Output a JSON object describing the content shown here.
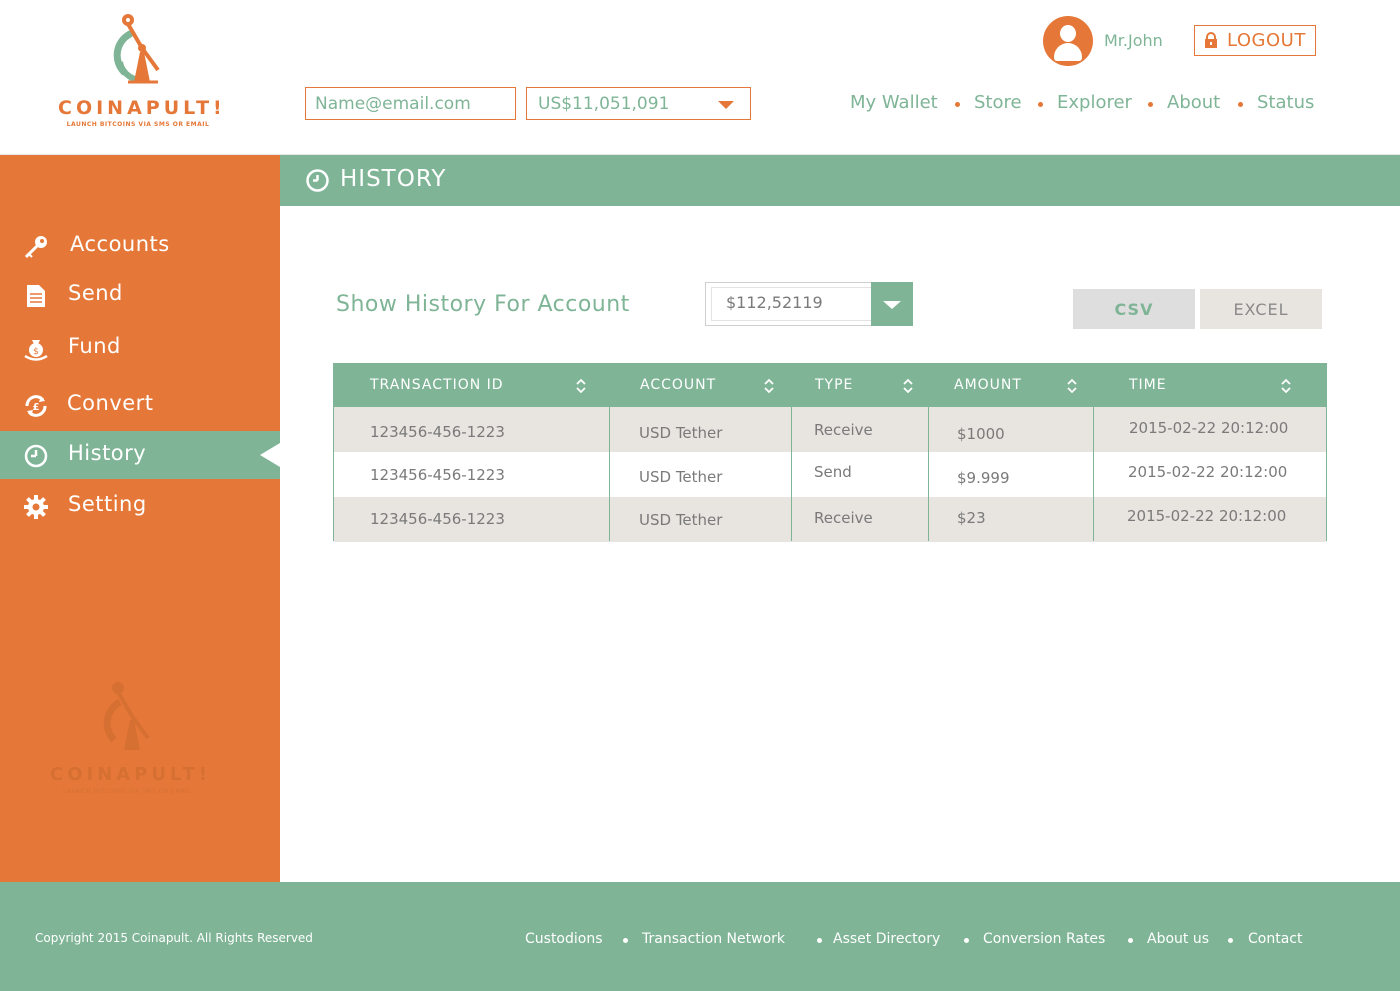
{
  "brand": {
    "name": "COINAPULT!",
    "tagline": "LAUNCH BITCOINS VIA SMS OR EMAIL",
    "orange": "#e57838",
    "green": "#7fb596"
  },
  "header": {
    "email_placeholder": "Name@email.com",
    "balance_value": "US$11,051,091",
    "user_name": "Mr.John",
    "logout_label": "LOGOUT",
    "nav": [
      {
        "label": "My Wallet"
      },
      {
        "label": "Store"
      },
      {
        "label": "Explorer"
      },
      {
        "label": "About"
      },
      {
        "label": "Status"
      }
    ]
  },
  "sidebar": {
    "items": [
      {
        "label": "Accounts",
        "icon": "key-icon"
      },
      {
        "label": "Send",
        "icon": "document-icon"
      },
      {
        "label": "Fund",
        "icon": "money-bag-icon"
      },
      {
        "label": "Convert",
        "icon": "currency-exchange-icon"
      },
      {
        "label": "History",
        "icon": "clock-icon",
        "active": true
      },
      {
        "label": "Setting",
        "icon": "gear-icon"
      }
    ]
  },
  "section": {
    "title": "HISTORY",
    "filter_label": "Show History For Account",
    "account_value": "$112,52119",
    "csv_label": "CSV",
    "excel_label": "EXCEL"
  },
  "table": {
    "columns": [
      "TRANSACTION ID",
      "ACCOUNT",
      "TYPE",
      "AMOUNT",
      "TIME"
    ],
    "rows": [
      {
        "id": "123456-456-1223",
        "account": "USD Tether",
        "type": "Receive",
        "amount": "$1000",
        "time": "2015-02-22 20:12:00"
      },
      {
        "id": "123456-456-1223",
        "account": "USD Tether",
        "type": "Send",
        "amount": "$9.999",
        "time": "2015-02-22 20:12:00"
      },
      {
        "id": "123456-456-1223",
        "account": "USD Tether",
        "type": "Receive",
        "amount": "$23",
        "time": "2015-02-22 20:12:00"
      }
    ]
  },
  "footer": {
    "copyright": "Copyright 2015 Coinapult. All Rights Reserved",
    "links": [
      {
        "label": "Custodions"
      },
      {
        "label": "Transaction Network"
      },
      {
        "label": "Asset Directory"
      },
      {
        "label": "Conversion Rates"
      },
      {
        "label": "About us"
      },
      {
        "label": "Contact"
      }
    ]
  }
}
